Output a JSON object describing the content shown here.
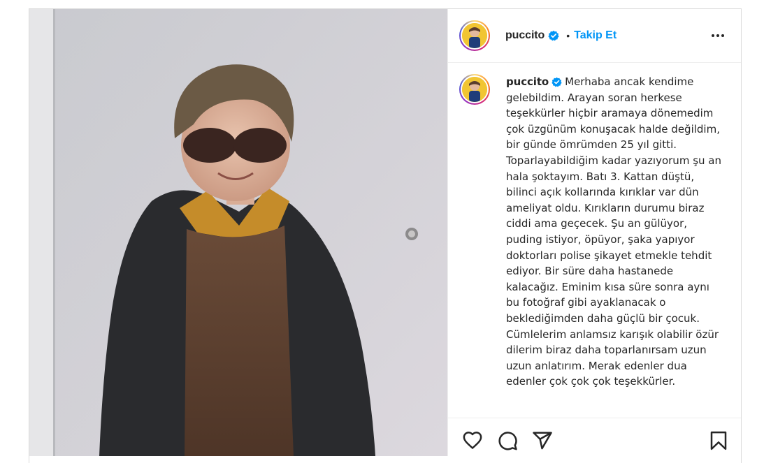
{
  "post": {
    "username": "puccito",
    "verified_icon": "verified-badge-icon",
    "separator": "•",
    "follow_label": "Takip Et",
    "more_icon": "more-options-icon",
    "caption": "Merhaba ancak kendime gelebildim. Arayan soran herkese teşekkürler hiçbir aramaya dönemedim çok üzgünüm konuşacak halde değildim, bir günde ömrümden 25 yıl gitti. Toparlayabildiğim kadar yazıyorum şu an hala şoktayım. Batı 3. Kattan düştü, bilinci açık kollarında kırıklar var dün ameliyat oldu. Kırıkların durumu biraz ciddi ama geçecek. Şu an gülüyor, puding istiyor, öpüyor, şaka yapıyor doktorları polise şikayet etmekle tehdit ediyor. Bir süre daha hastanede kalacağız. Eminim kısa süre sonra aynı bu fotoğraf gibi ayaklanacak o beklediğimden daha güçlü bir çocuk. Cümlelerim anlamsız karışık olabilir özür dilerim biraz daha toparlanırsam uzun uzun anlatırım. Merak edenler dua edenler çok çok çok teşekkürler.",
    "actions": {
      "like_icon": "heart-icon",
      "comment_icon": "comment-icon",
      "share_icon": "share-icon",
      "save_icon": "bookmark-icon"
    }
  },
  "colors": {
    "accent": "#0095f6",
    "verified": "#0095f6",
    "text": "#262626",
    "border": "#dbdbdb"
  }
}
